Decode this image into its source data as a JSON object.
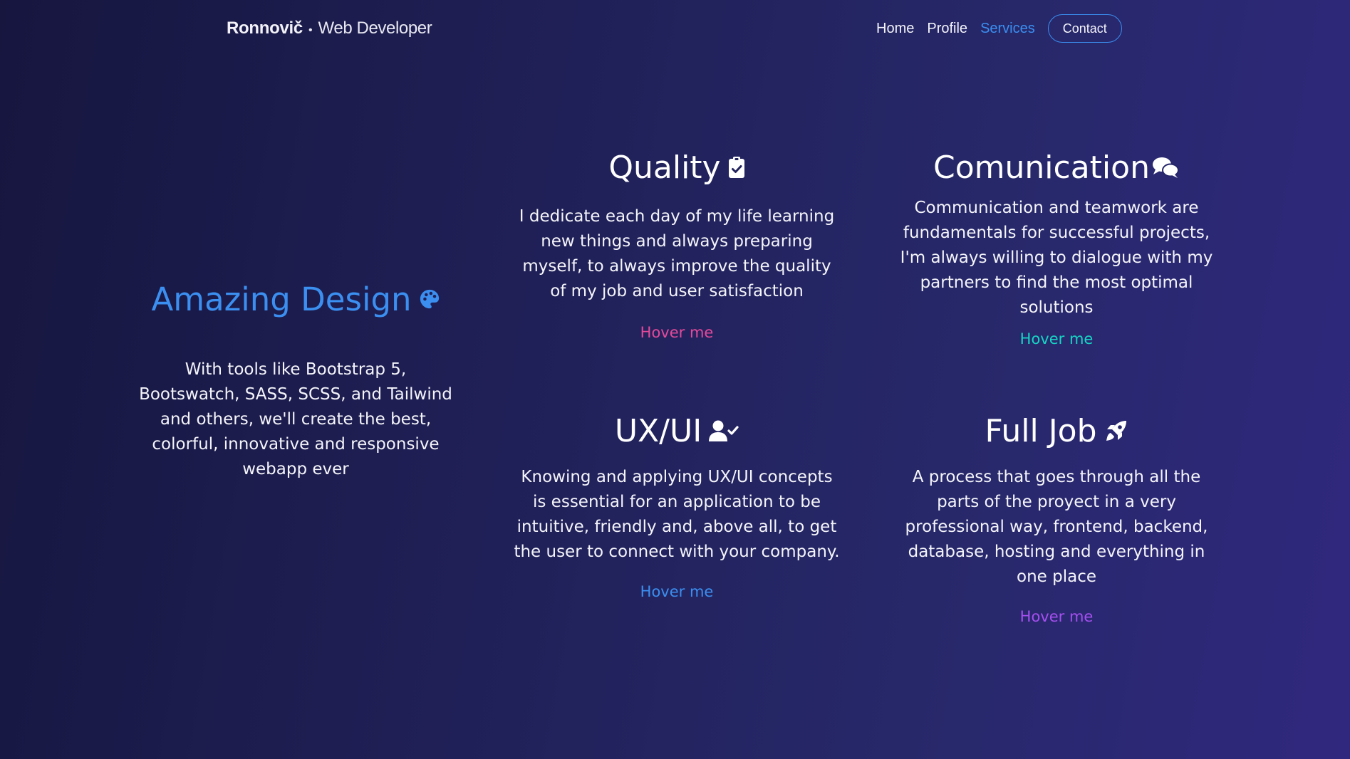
{
  "header": {
    "brand_name": "Ronnovič",
    "brand_separator": "•",
    "brand_role": "Web Developer",
    "nav": [
      {
        "label": "Home",
        "active": false
      },
      {
        "label": "Profile",
        "active": false
      },
      {
        "label": "Services",
        "active": true
      }
    ],
    "contact_label": "Contact"
  },
  "colors": {
    "accent_blue": "#3b8ff0",
    "pink": "#e54a9a",
    "teal": "#16d6c4",
    "purple": "#a64ff0"
  },
  "services": {
    "amazing": {
      "title": "Amazing Design",
      "icon": "palette-icon",
      "text": "With tools like Bootstrap 5, Bootswatch, SASS, SCSS, and Tailwind and others, we'll create the best, colorful, innovative and responsive webapp ever"
    },
    "quality": {
      "title": "Quality",
      "icon": "clipboard-check-icon",
      "text": "I dedicate each day of my life learning new things and always preparing myself, to always improve the quality of my job and user satisfaction",
      "hover": "Hover me"
    },
    "communication": {
      "title": "Comunication",
      "icon": "comments-icon",
      "text": "Communication and teamwork are fundamentals for successful projects, I'm always willing to dialogue with my partners to find the most optimal solutions",
      "hover": "Hover me"
    },
    "uxui": {
      "title": "UX/UI",
      "icon": "user-check-icon",
      "text": "Knowing and applying UX/UI concepts is essential for an application to be intuitive, friendly and, above all, to get the user to connect with your company.",
      "hover": "Hover me"
    },
    "fulljob": {
      "title": "Full Job",
      "icon": "rocket-icon",
      "text": "A process that goes through all the parts of the proyect in a very professional way, frontend, backend, database, hosting and everything in one place",
      "hover": "Hover me"
    }
  }
}
